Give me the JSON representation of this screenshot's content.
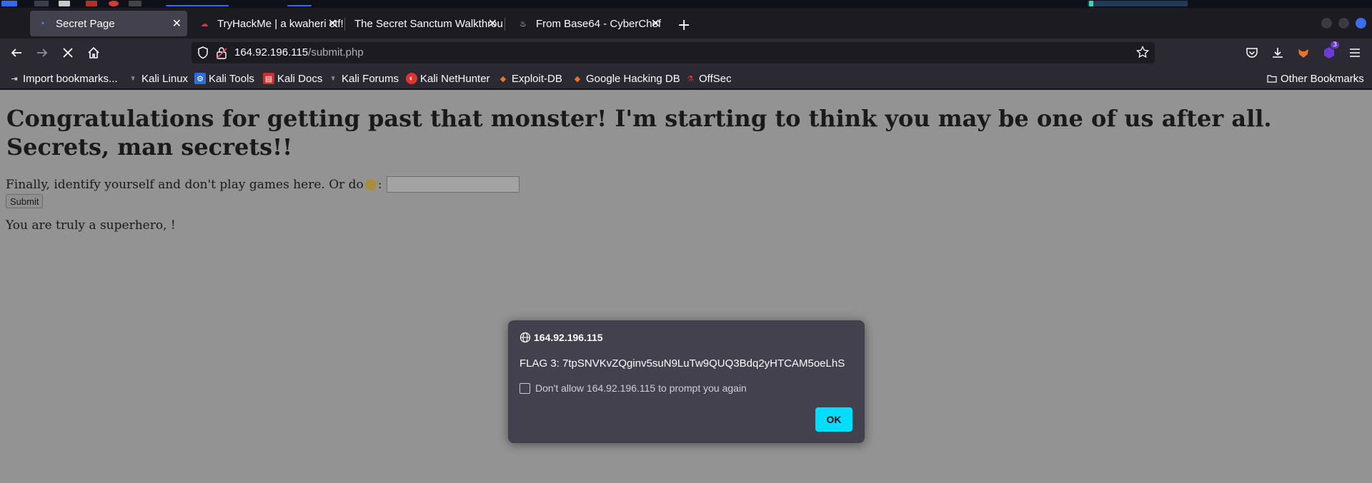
{
  "tabs": [
    {
      "title": "Secret Page",
      "active": true
    },
    {
      "title": "TryHackMe | a kwaheri ctf!"
    },
    {
      "title": "The Secret Sanctum Walkthrough"
    },
    {
      "title": "From Base64 - CyberChef"
    }
  ],
  "nav": {
    "url_host": "164.92.196.115",
    "url_path": "/submit.php",
    "extension_badge": "3"
  },
  "bookmarks": {
    "items": [
      {
        "label": "Import bookmarks..."
      },
      {
        "label": "Kali Linux"
      },
      {
        "label": "Kali Tools"
      },
      {
        "label": "Kali Docs"
      },
      {
        "label": "Kali Forums"
      },
      {
        "label": "Kali NetHunter"
      },
      {
        "label": "Exploit-DB"
      },
      {
        "label": "Google Hacking DB"
      },
      {
        "label": "OffSec"
      }
    ],
    "other": "Other Bookmarks"
  },
  "page": {
    "heading": "Congratulations for getting past that monster! I'm starting to think you may be one of us after all. Secrets, man secrets!!",
    "prompt_text": "Finally, identify yourself and don't play games here. Or do",
    "prompt_suffix": ":",
    "input_value": "",
    "submit_label": "Submit",
    "result_text": "You are truly a superhero, !"
  },
  "dialog": {
    "origin": "164.92.196.115",
    "message": "FLAG 3: 7tpSNVKvZQginv5suN9LuTw9QUQ3Bdq2yHTCAM5oeLhS",
    "checkbox_label": "Don't allow 164.92.196.115 to prompt you again",
    "ok_label": "OK"
  },
  "colors": {
    "accent": "#00ddff",
    "tab_active": "#42414d",
    "toolbar": "#2b2a33",
    "page_dimmed": "#939393"
  }
}
